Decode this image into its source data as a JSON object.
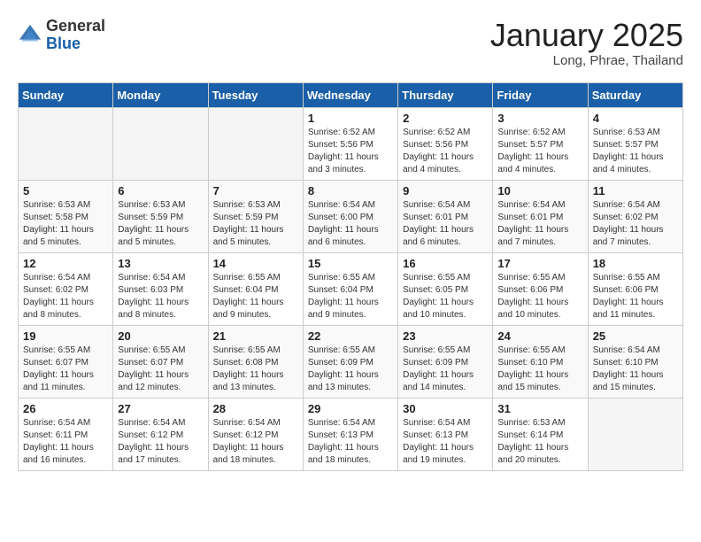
{
  "header": {
    "logo_general": "General",
    "logo_blue": "Blue",
    "month": "January 2025",
    "location": "Long, Phrae, Thailand"
  },
  "weekdays": [
    "Sunday",
    "Monday",
    "Tuesday",
    "Wednesday",
    "Thursday",
    "Friday",
    "Saturday"
  ],
  "weeks": [
    [
      {
        "day": "",
        "sunrise": "",
        "sunset": "",
        "daylight": ""
      },
      {
        "day": "",
        "sunrise": "",
        "sunset": "",
        "daylight": ""
      },
      {
        "day": "",
        "sunrise": "",
        "sunset": "",
        "daylight": ""
      },
      {
        "day": "1",
        "sunrise": "Sunrise: 6:52 AM",
        "sunset": "Sunset: 5:56 PM",
        "daylight": "Daylight: 11 hours and 3 minutes."
      },
      {
        "day": "2",
        "sunrise": "Sunrise: 6:52 AM",
        "sunset": "Sunset: 5:56 PM",
        "daylight": "Daylight: 11 hours and 4 minutes."
      },
      {
        "day": "3",
        "sunrise": "Sunrise: 6:52 AM",
        "sunset": "Sunset: 5:57 PM",
        "daylight": "Daylight: 11 hours and 4 minutes."
      },
      {
        "day": "4",
        "sunrise": "Sunrise: 6:53 AM",
        "sunset": "Sunset: 5:57 PM",
        "daylight": "Daylight: 11 hours and 4 minutes."
      }
    ],
    [
      {
        "day": "5",
        "sunrise": "Sunrise: 6:53 AM",
        "sunset": "Sunset: 5:58 PM",
        "daylight": "Daylight: 11 hours and 5 minutes."
      },
      {
        "day": "6",
        "sunrise": "Sunrise: 6:53 AM",
        "sunset": "Sunset: 5:59 PM",
        "daylight": "Daylight: 11 hours and 5 minutes."
      },
      {
        "day": "7",
        "sunrise": "Sunrise: 6:53 AM",
        "sunset": "Sunset: 5:59 PM",
        "daylight": "Daylight: 11 hours and 5 minutes."
      },
      {
        "day": "8",
        "sunrise": "Sunrise: 6:54 AM",
        "sunset": "Sunset: 6:00 PM",
        "daylight": "Daylight: 11 hours and 6 minutes."
      },
      {
        "day": "9",
        "sunrise": "Sunrise: 6:54 AM",
        "sunset": "Sunset: 6:01 PM",
        "daylight": "Daylight: 11 hours and 6 minutes."
      },
      {
        "day": "10",
        "sunrise": "Sunrise: 6:54 AM",
        "sunset": "Sunset: 6:01 PM",
        "daylight": "Daylight: 11 hours and 7 minutes."
      },
      {
        "day": "11",
        "sunrise": "Sunrise: 6:54 AM",
        "sunset": "Sunset: 6:02 PM",
        "daylight": "Daylight: 11 hours and 7 minutes."
      }
    ],
    [
      {
        "day": "12",
        "sunrise": "Sunrise: 6:54 AM",
        "sunset": "Sunset: 6:02 PM",
        "daylight": "Daylight: 11 hours and 8 minutes."
      },
      {
        "day": "13",
        "sunrise": "Sunrise: 6:54 AM",
        "sunset": "Sunset: 6:03 PM",
        "daylight": "Daylight: 11 hours and 8 minutes."
      },
      {
        "day": "14",
        "sunrise": "Sunrise: 6:55 AM",
        "sunset": "Sunset: 6:04 PM",
        "daylight": "Daylight: 11 hours and 9 minutes."
      },
      {
        "day": "15",
        "sunrise": "Sunrise: 6:55 AM",
        "sunset": "Sunset: 6:04 PM",
        "daylight": "Daylight: 11 hours and 9 minutes."
      },
      {
        "day": "16",
        "sunrise": "Sunrise: 6:55 AM",
        "sunset": "Sunset: 6:05 PM",
        "daylight": "Daylight: 11 hours and 10 minutes."
      },
      {
        "day": "17",
        "sunrise": "Sunrise: 6:55 AM",
        "sunset": "Sunset: 6:06 PM",
        "daylight": "Daylight: 11 hours and 10 minutes."
      },
      {
        "day": "18",
        "sunrise": "Sunrise: 6:55 AM",
        "sunset": "Sunset: 6:06 PM",
        "daylight": "Daylight: 11 hours and 11 minutes."
      }
    ],
    [
      {
        "day": "19",
        "sunrise": "Sunrise: 6:55 AM",
        "sunset": "Sunset: 6:07 PM",
        "daylight": "Daylight: 11 hours and 11 minutes."
      },
      {
        "day": "20",
        "sunrise": "Sunrise: 6:55 AM",
        "sunset": "Sunset: 6:07 PM",
        "daylight": "Daylight: 11 hours and 12 minutes."
      },
      {
        "day": "21",
        "sunrise": "Sunrise: 6:55 AM",
        "sunset": "Sunset: 6:08 PM",
        "daylight": "Daylight: 11 hours and 13 minutes."
      },
      {
        "day": "22",
        "sunrise": "Sunrise: 6:55 AM",
        "sunset": "Sunset: 6:09 PM",
        "daylight": "Daylight: 11 hours and 13 minutes."
      },
      {
        "day": "23",
        "sunrise": "Sunrise: 6:55 AM",
        "sunset": "Sunset: 6:09 PM",
        "daylight": "Daylight: 11 hours and 14 minutes."
      },
      {
        "day": "24",
        "sunrise": "Sunrise: 6:55 AM",
        "sunset": "Sunset: 6:10 PM",
        "daylight": "Daylight: 11 hours and 15 minutes."
      },
      {
        "day": "25",
        "sunrise": "Sunrise: 6:54 AM",
        "sunset": "Sunset: 6:10 PM",
        "daylight": "Daylight: 11 hours and 15 minutes."
      }
    ],
    [
      {
        "day": "26",
        "sunrise": "Sunrise: 6:54 AM",
        "sunset": "Sunset: 6:11 PM",
        "daylight": "Daylight: 11 hours and 16 minutes."
      },
      {
        "day": "27",
        "sunrise": "Sunrise: 6:54 AM",
        "sunset": "Sunset: 6:12 PM",
        "daylight": "Daylight: 11 hours and 17 minutes."
      },
      {
        "day": "28",
        "sunrise": "Sunrise: 6:54 AM",
        "sunset": "Sunset: 6:12 PM",
        "daylight": "Daylight: 11 hours and 18 minutes."
      },
      {
        "day": "29",
        "sunrise": "Sunrise: 6:54 AM",
        "sunset": "Sunset: 6:13 PM",
        "daylight": "Daylight: 11 hours and 18 minutes."
      },
      {
        "day": "30",
        "sunrise": "Sunrise: 6:54 AM",
        "sunset": "Sunset: 6:13 PM",
        "daylight": "Daylight: 11 hours and 19 minutes."
      },
      {
        "day": "31",
        "sunrise": "Sunrise: 6:53 AM",
        "sunset": "Sunset: 6:14 PM",
        "daylight": "Daylight: 11 hours and 20 minutes."
      },
      {
        "day": "",
        "sunrise": "",
        "sunset": "",
        "daylight": ""
      }
    ]
  ]
}
